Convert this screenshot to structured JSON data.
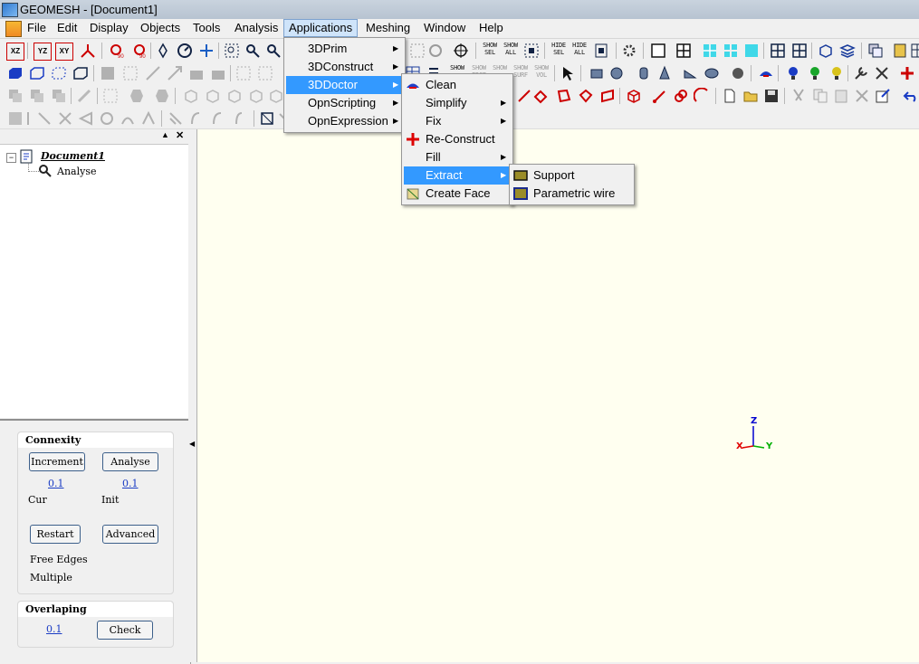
{
  "window": {
    "title": "GEOMESH - [Document1]"
  },
  "menubar": {
    "items": [
      "File",
      "Edit",
      "Display",
      "Objects",
      "Tools",
      "Analysis",
      "Applications",
      "Meshing",
      "Window",
      "Help"
    ]
  },
  "toolbar": {
    "show_sel": "SHOW\nSEL",
    "show_all": "SHOW\nALL",
    "hide_sel": "HIDE\nSEL",
    "hide_all": "HIDE\nALL",
    "show": "SHOW",
    "show_edge": "SHOW\nEDGE",
    "show_surf": "SHOW\nSURF",
    "show_vol": "SHOW\nVOL",
    "xz": "XZ",
    "yz": "YZ",
    "xy": "XY"
  },
  "tree": {
    "root": "Document1",
    "child": "Analyse"
  },
  "connexity": {
    "title": "Connexity",
    "increment_btn": "Increment",
    "analyse_btn": "Analyse",
    "cur_value": "0.1",
    "init_value": "0.1",
    "cur_label": "Cur",
    "init_label": "Init",
    "restart_btn": "Restart",
    "advanced_btn": "Advanced",
    "free_edges_label": "Free Edges",
    "multiple_label": "Multiple"
  },
  "overlaping": {
    "title": "Overlaping",
    "value": "0.1",
    "check_btn": "Check"
  },
  "menus": {
    "applications": [
      "3DPrim",
      "3DConstruct",
      "3DDoctor",
      "OpnScripting",
      "OpnExpression"
    ],
    "doctor": [
      "Clean",
      "Simplify",
      "Fix",
      "Re-Construct",
      "Fill",
      "Extract",
      "Create Face"
    ],
    "extract": [
      "Support",
      "Parametric wire"
    ]
  },
  "axes": {
    "z": "Z",
    "x": "X",
    "y": "Y"
  },
  "colors": {
    "highlight": "#3399ff",
    "viewport_bg": "#fffff0",
    "axis_x": "#e00000",
    "axis_y": "#00b000",
    "axis_z": "#0000d0"
  }
}
